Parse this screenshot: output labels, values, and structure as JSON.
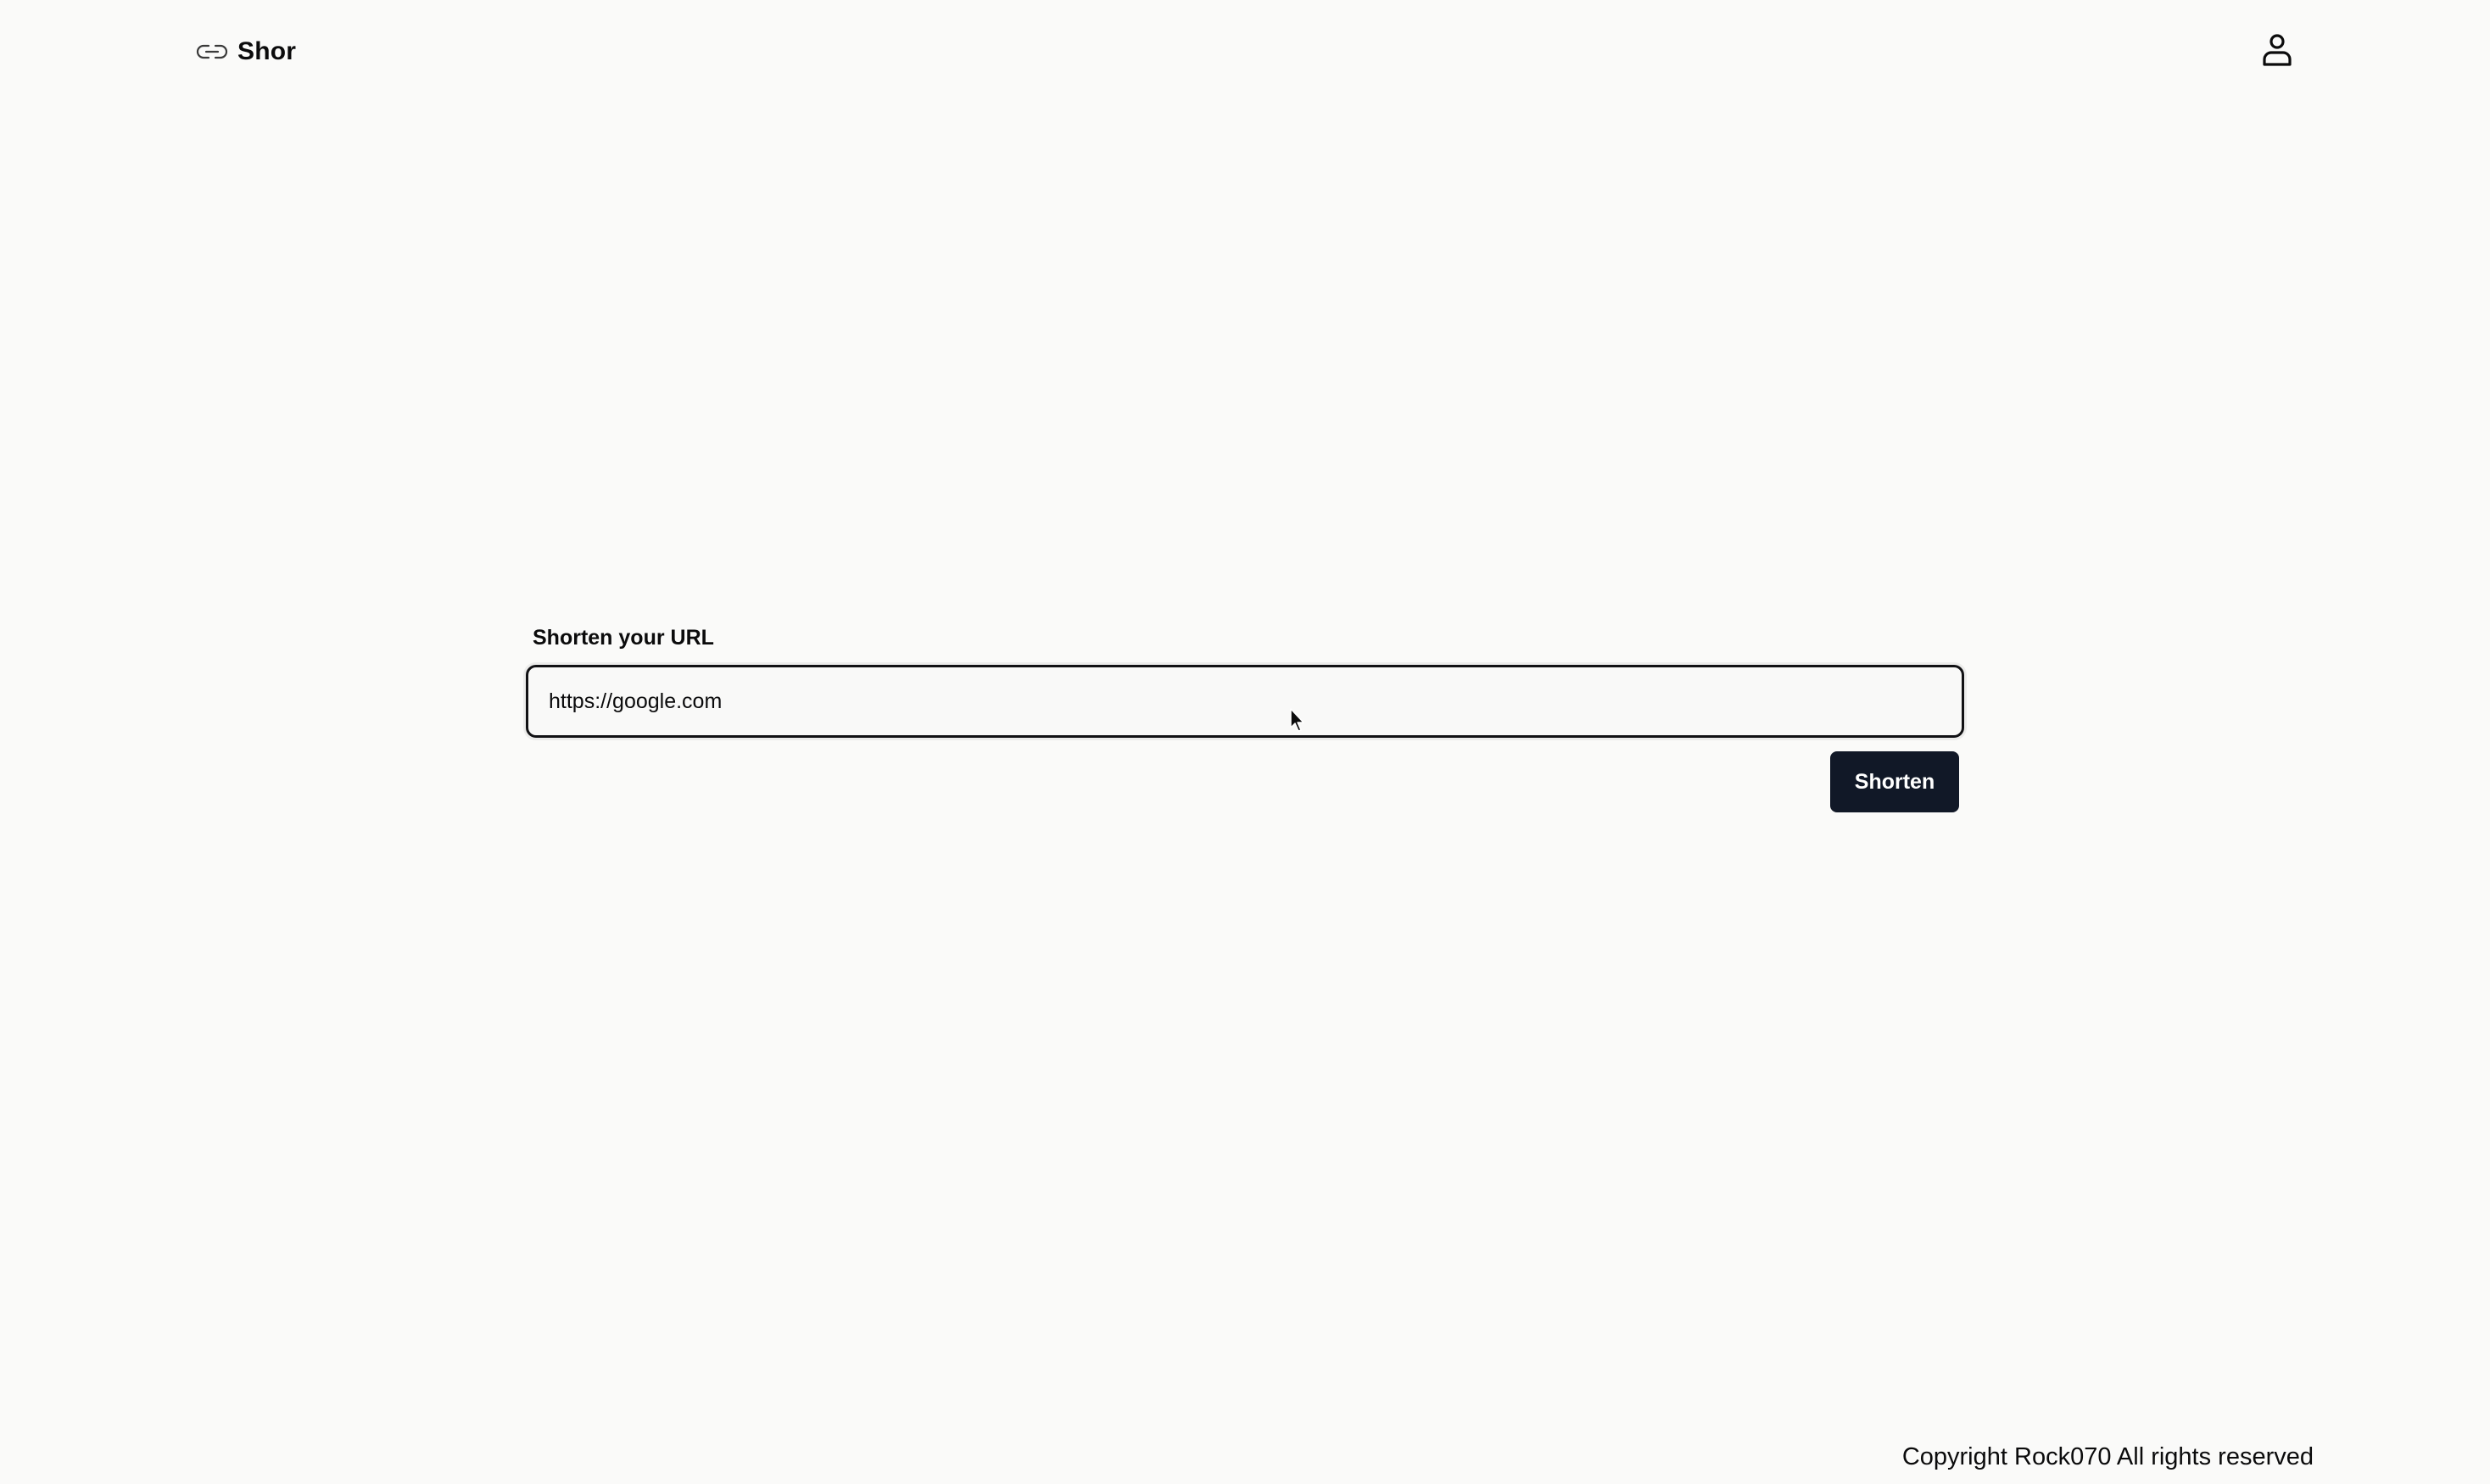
{
  "header": {
    "brand_icon": "link-icon",
    "brand_name": "Shor",
    "user_icon": "user-icon"
  },
  "form": {
    "label": "Shorten your URL",
    "url_value": "https://google.com",
    "submit_label": "Shorten"
  },
  "footer": {
    "text": "Copyright Rock070 All rights reserved"
  },
  "colors": {
    "background": "#fafaf9",
    "text": "#0b0b0c",
    "button_bg": "#111827",
    "button_text": "#ffffff",
    "input_border": "#111114"
  }
}
